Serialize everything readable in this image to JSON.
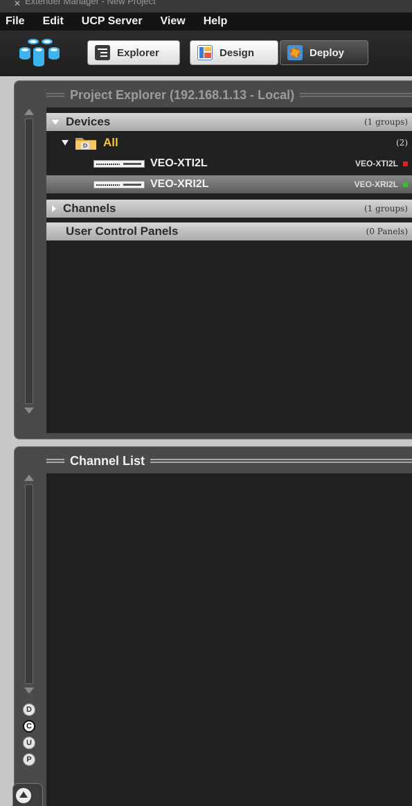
{
  "window": {
    "title": "Extender Manager - New Project"
  },
  "menu": [
    "File",
    "Edit",
    "UCP Server",
    "View",
    "Help"
  ],
  "toolbar": {
    "explorer_label": "Explorer",
    "design_label": "Design",
    "deploy_label": "Deploy"
  },
  "explorer": {
    "title": "Project Explorer (192.168.1.13 - Local)",
    "devices": {
      "label": "Devices",
      "count": "(1 groups)"
    },
    "all": {
      "label": "All",
      "count": "(2)"
    },
    "device_rows": [
      {
        "name": "VEO-XTI2L",
        "model": "VEO-XTI2L",
        "status_color": "#e02020"
      },
      {
        "name": "VEO-XRI2L",
        "model": "VEO-XRI2L",
        "status_color": "#2ec42e"
      }
    ],
    "channels": {
      "label": "Channels",
      "count": "(1 groups)"
    },
    "ucp": {
      "label": "User Control Panels",
      "count": "(0 Panels)"
    }
  },
  "channel_list": {
    "title": "Channel List"
  },
  "side_tabs": [
    "D",
    "C",
    "U",
    "P"
  ],
  "colors": {
    "accent_folder": "#f3c43a",
    "status_red": "#e02020",
    "status_green": "#2ec42e"
  }
}
